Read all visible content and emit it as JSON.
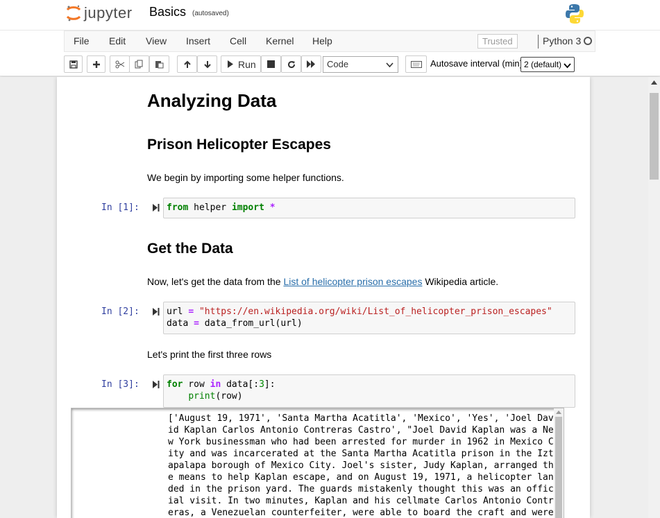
{
  "header": {
    "logo_text": "jupyter",
    "notebook_title": "Basics",
    "autosave_status": "(autosaved)"
  },
  "menu": {
    "items": [
      "File",
      "Edit",
      "View",
      "Insert",
      "Cell",
      "Kernel",
      "Help"
    ],
    "trusted": "Trusted",
    "kernel_name": "Python 3"
  },
  "toolbar": {
    "run_label": "Run",
    "cell_type": "Code",
    "autosave_label": "Autosave interval (min):",
    "autosave_value": "2 (default)",
    "icons": [
      "save-icon",
      "plus-icon",
      "cut-icon",
      "copy-icon",
      "paste-icon",
      "arrow-up-icon",
      "arrow-down-icon",
      "run-icon",
      "stop-icon",
      "restart-icon",
      "fast-forward-icon",
      "keyboard-icon"
    ]
  },
  "notebook": {
    "heading1": "Analyzing Data",
    "heading2": "Prison Helicopter Escapes",
    "intro": "We begin by importing some helper functions.",
    "cell1": {
      "prompt": "In [1]:"
    },
    "heading3": "Get the Data",
    "para2_before": "Now, let's get the data from the ",
    "para2_link": "List of helicopter prison escapes",
    "para2_after": " Wikipedia article.",
    "cell2": {
      "prompt": "In [2]:"
    },
    "para3": "Let's print the first three rows",
    "cell3": {
      "prompt": "In [3]:"
    },
    "output": "['August 19, 1971', 'Santa Martha Acatitla', 'Mexico', 'Yes', 'Joel David Kaplan Carlos Antonio Contreras Castro', \"Joel David Kaplan was a New York businessman who had been arrested for murder in 1962 in Mexico City and was incarcerated at the Santa Martha Acatitla prison in the Iztapalapa borough of Mexico City. Joel's sister, Judy Kaplan, arranged the means to help Kaplan escape, and on August 19, 1971, a helicopter landed in the prison yard. The guards mistakenly thought this was an official visit. In two minutes, Kaplan and his cellmate Carlos Antonio Contreras, a Venezuelan counterfeiter, were able to board the craft and were piloted away, before"
  }
}
